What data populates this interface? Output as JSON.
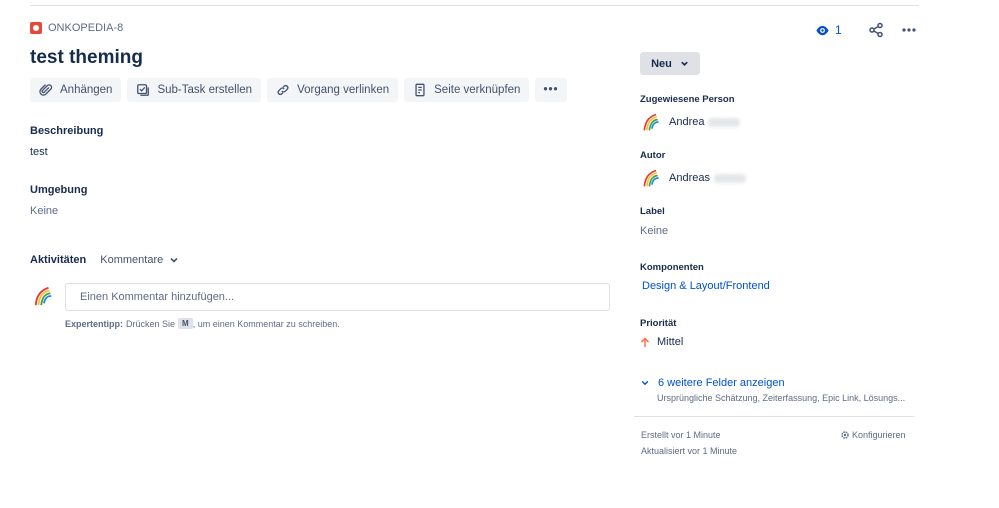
{
  "issue": {
    "key": "ONKOPEDIA-8",
    "title": "test theming",
    "watchers": "1"
  },
  "icons": {
    "issue_type": "bug-icon",
    "watch": "eye-icon",
    "share": "share-icon",
    "more": "more-icon"
  },
  "toolbar": {
    "attach": "Anhängen",
    "subtask": "Sub-Task erstellen",
    "link_issue": "Vorgang verlinken",
    "link_page": "Seite verknüpfen",
    "more": "•••"
  },
  "description": {
    "label": "Beschreibung",
    "value": "test"
  },
  "environment": {
    "label": "Umgebung",
    "value": "Keine"
  },
  "activity": {
    "label": "Aktivitäten",
    "filter": "Kommentare",
    "comment_placeholder": "Einen Kommentar hinzufügen...",
    "tip_bold": "Expertentipp:",
    "tip_before": "Drücken Sie",
    "tip_key": "M",
    "tip_after": ", um einen Kommentar zu schreiben."
  },
  "sidebar": {
    "status": "Neu",
    "assignee_label": "Zugewiesene Person",
    "assignee_name": "Andrea",
    "reporter_label": "Autor",
    "reporter_name": "Andreas",
    "label_label": "Label",
    "label_value": "Keine",
    "components_label": "Komponenten",
    "components_value": "Design & Layout/Frontend",
    "priority_label": "Priorität",
    "priority_value": "Mittel",
    "more_fields": "6 weitere Felder anzeigen",
    "more_fields_sub": "Ursprüngliche Schätzung, Zeiterfassung, Epic Link, Lösungs...",
    "created": "Erstellt vor 1 Minute",
    "updated": "Aktualisiert vor 1 Minute",
    "configure": "Konfigurieren"
  },
  "colors": {
    "link": "#0052cc",
    "bug": "#e5493a",
    "priority_medium": "#ff7452"
  }
}
